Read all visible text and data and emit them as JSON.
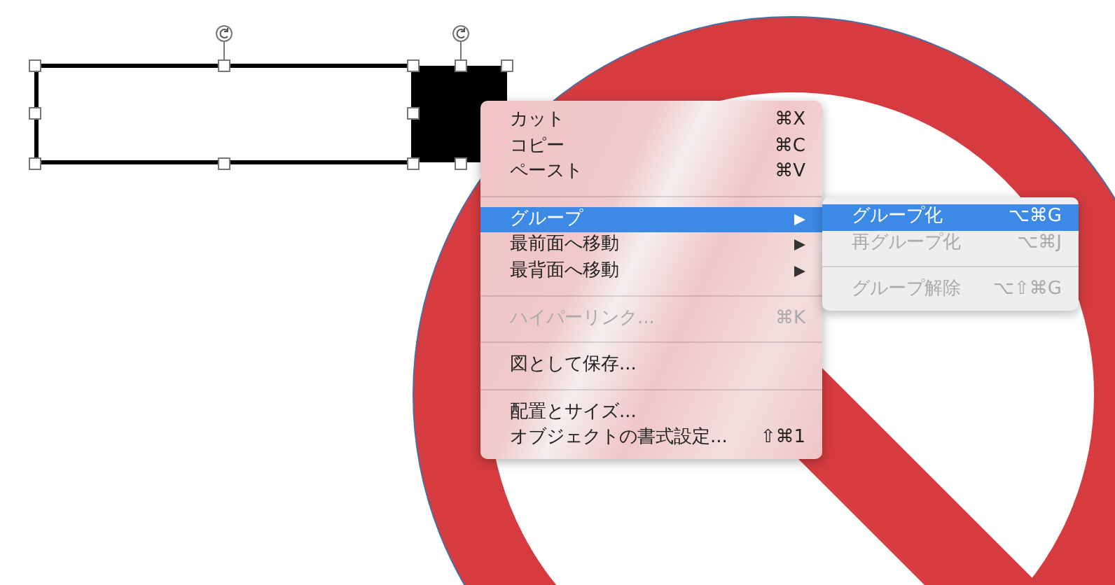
{
  "context_menu": {
    "items": [
      {
        "kind": "item",
        "label": "カット",
        "shortcut": "⌘X",
        "submenu": false,
        "selected": false,
        "disabled": false
      },
      {
        "kind": "item",
        "label": "コピー",
        "shortcut": "⌘C",
        "submenu": false,
        "selected": false,
        "disabled": false
      },
      {
        "kind": "item",
        "label": "ペースト",
        "shortcut": "⌘V",
        "submenu": false,
        "selected": false,
        "disabled": false
      },
      {
        "kind": "separator"
      },
      {
        "kind": "item",
        "label": "グループ",
        "submenu": true,
        "selected": true,
        "disabled": false
      },
      {
        "kind": "item",
        "label": "最前面へ移動",
        "submenu": true,
        "selected": false,
        "disabled": false
      },
      {
        "kind": "item",
        "label": "最背面へ移動",
        "submenu": true,
        "selected": false,
        "disabled": false
      },
      {
        "kind": "separator"
      },
      {
        "kind": "item",
        "label": "ハイパーリンク...",
        "shortcut": "⌘K",
        "submenu": false,
        "selected": false,
        "disabled": true
      },
      {
        "kind": "separator"
      },
      {
        "kind": "item",
        "label": "図として保存...",
        "submenu": false,
        "selected": false,
        "disabled": false
      },
      {
        "kind": "separator"
      },
      {
        "kind": "item",
        "label": "配置とサイズ...",
        "submenu": false,
        "selected": false,
        "disabled": false
      },
      {
        "kind": "item",
        "label": "オブジェクトの書式設定...",
        "shortcut": "⇧⌘1",
        "submenu": false,
        "selected": false,
        "disabled": false
      }
    ]
  },
  "submenu": {
    "items": [
      {
        "kind": "item",
        "label": "グループ化",
        "shortcut": "⌥⌘G",
        "selected": true,
        "disabled": false
      },
      {
        "kind": "item",
        "label": "再グループ化",
        "shortcut": "⌥⌘J",
        "selected": false,
        "disabled": true
      },
      {
        "kind": "separator"
      },
      {
        "kind": "item",
        "label": "グループ解除",
        "shortcut": "⌥⇧⌘G",
        "selected": false,
        "disabled": true
      }
    ]
  }
}
